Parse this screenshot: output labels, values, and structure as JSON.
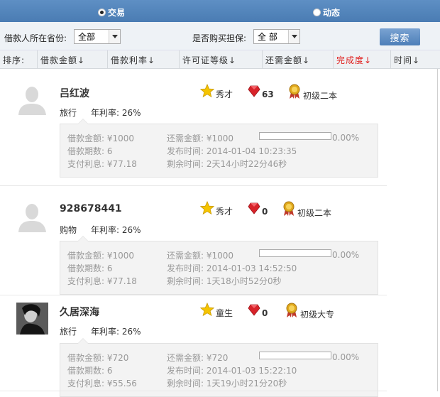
{
  "topbar": {
    "tabs": [
      {
        "label": "交易",
        "selected": true
      },
      {
        "label": "动态",
        "selected": false
      }
    ]
  },
  "filter": {
    "province_label": "借款人所在省份:",
    "province_value": "全部",
    "guarantee_label": "是否购买担保:",
    "guarantee_value": "全 部",
    "search_label": "搜索"
  },
  "sortbar": {
    "label": "排序:",
    "columns": [
      "借款金额↓",
      "借款利率↓",
      "许可证等级↓",
      "还需金额↓",
      "完成度↓",
      "时间↓"
    ]
  },
  "records": [
    {
      "name": "吕红波",
      "purpose": "旅行",
      "rate": "年利率: 26%",
      "rank": "秀才",
      "gems": "63",
      "level": "初级二本",
      "avatar": "default",
      "amount": "借款金额: ¥1000",
      "periods": "借款期数: 6",
      "interest": "支付利息: ¥77.18",
      "remaining": "还需金额: ¥1000",
      "published": "发布时间: 2014-01-04 10:23:35",
      "time_left": "剩余时间: 2天14小时22分46秒",
      "progress": 0,
      "progress_text": "0.00%"
    },
    {
      "name": "928678441",
      "purpose": "购物",
      "rate": "年利率: 26%",
      "rank": "秀才",
      "gems": "0",
      "level": "初级二本",
      "avatar": "default",
      "amount": "借款金额: ¥1000",
      "periods": "借款期数: 6",
      "interest": "支付利息: ¥77.18",
      "remaining": "还需金额: ¥1000",
      "published": "发布时间: 2014-01-03 14:52:50",
      "time_left": "剩余时间: 1天18小时52分0秒",
      "progress": 0,
      "progress_text": "0.00%"
    },
    {
      "name": "久居深海",
      "purpose": "旅行",
      "rate": "年利率: 26%",
      "rank": "童生",
      "gems": "0",
      "level": "初级大专",
      "avatar": "photo",
      "amount": "借款金额: ¥720",
      "periods": "借款期数: 6",
      "interest": "支付利息: ¥55.56",
      "remaining": "还需金额: ¥720",
      "published": "发布时间: 2014-01-03 15:22:10",
      "time_left": "剩余时间: 1天19小时21分20秒",
      "progress": 0,
      "progress_text": "0.00%"
    }
  ],
  "icons": {
    "rank": "star-icon",
    "gems": "red-gem-icon",
    "level": "medal-icon",
    "default_avatar": "default-avatar-icon",
    "photo_avatar": "user-photo"
  },
  "colors": {
    "topbar": "#4a7cb3",
    "accent_red": "#e0201e",
    "gem": "#d8232a",
    "star": "#f5c400"
  }
}
